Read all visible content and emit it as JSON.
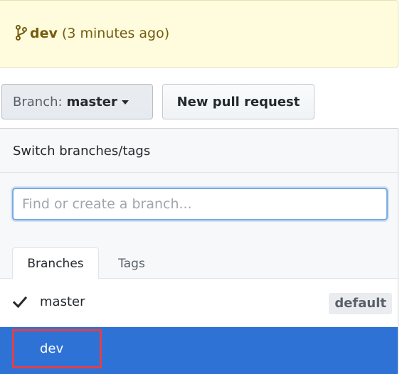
{
  "banner": {
    "branch_icon": "git-branch-icon",
    "branch_name": "dev",
    "time": "(3 minutes ago)"
  },
  "toolbar": {
    "branch_prefix": "Branch:",
    "branch_current": "master",
    "new_pull_request": "New pull request"
  },
  "dropdown": {
    "title": "Switch branches/tags",
    "filter_placeholder": "Find or create a branch...",
    "filter_value": "",
    "tabs": [
      {
        "label": "Branches",
        "selected": true
      },
      {
        "label": "Tags",
        "selected": false
      }
    ],
    "branches": [
      {
        "name": "master",
        "checked": true,
        "badge": "default",
        "highlighted": false
      },
      {
        "name": "dev",
        "checked": false,
        "badge": "",
        "highlighted": true
      }
    ]
  },
  "colors": {
    "banner_bg": "#fffbdd",
    "selected_row": "#2f72d6",
    "annotation_box": "#e0404a",
    "input_focus": "#7aa9e2"
  }
}
